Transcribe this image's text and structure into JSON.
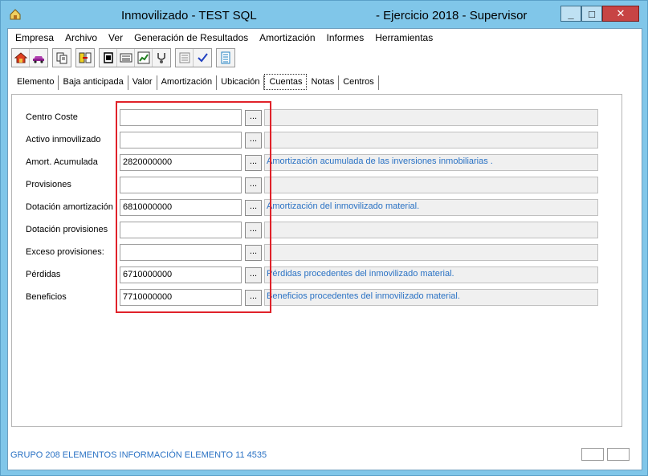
{
  "window": {
    "title_left": "Inmovilizado - TEST SQL",
    "title_right": "- Ejercicio 2018 - Supervisor",
    "minimize_label": "_",
    "maximize_label": "□",
    "close_label": "✕"
  },
  "menu": [
    {
      "label": "Empresa"
    },
    {
      "label": "Archivo"
    },
    {
      "label": "Ver"
    },
    {
      "label": "Generación de Resultados"
    },
    {
      "label": "Amortización"
    },
    {
      "label": "Informes"
    },
    {
      "label": "Herramientas"
    }
  ],
  "tabs": [
    {
      "label": "Elemento"
    },
    {
      "label": "Baja anticipada"
    },
    {
      "label": "Valor"
    },
    {
      "label": "Amortización"
    },
    {
      "label": "Ubicación"
    },
    {
      "label": "Cuentas"
    },
    {
      "label": "Notas"
    },
    {
      "label": "Centros"
    }
  ],
  "active_tab": "Cuentas",
  "browse_label": "...",
  "rows": [
    {
      "label": "Centro Coste",
      "value": "",
      "description": ""
    },
    {
      "label": "Activo inmovilizado",
      "value": "",
      "description": ""
    },
    {
      "label": "Amort. Acumulada",
      "value": "2820000000",
      "description": "Amortización acumulada de las inversiones inmobiliarias ."
    },
    {
      "label": "Provisiones",
      "value": "",
      "description": ""
    },
    {
      "label": "Dotación amortización",
      "value": "6810000000",
      "description": "Amortización del inmovilizado material."
    },
    {
      "label": "Dotación provisiones",
      "value": "",
      "description": ""
    },
    {
      "label": "Exceso provisiones:",
      "value": "",
      "description": ""
    },
    {
      "label": "Pérdidas",
      "value": "6710000000",
      "description": "Pérdidas procedentes del inmovilizado material."
    },
    {
      "label": "Beneficios",
      "value": "7710000000",
      "description": "Beneficios procedentes del inmovilizado material."
    }
  ],
  "status": {
    "text": "GRUPO 208 ELEMENTOS INFORMACIÓN ELEMENTO 11 4535"
  },
  "colors": {
    "titlebar": "#80c6e9",
    "description_text": "#2a72c4",
    "highlight_border": "#e0222a",
    "close_button": "#c74444"
  }
}
